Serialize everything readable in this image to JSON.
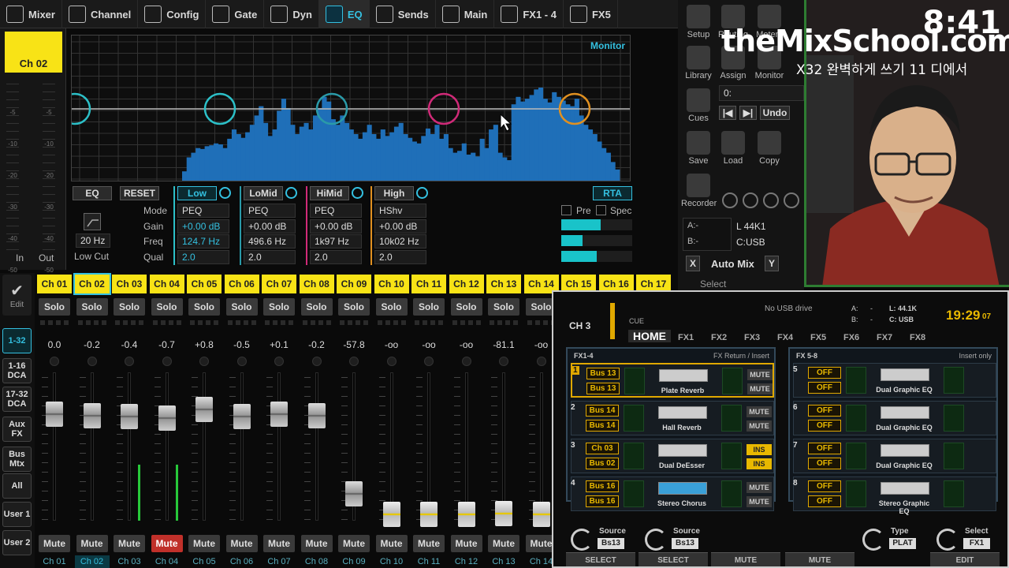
{
  "tabs": [
    {
      "label": "Mixer",
      "icon": "mixer-icon"
    },
    {
      "label": "Channel",
      "icon": "channel-icon"
    },
    {
      "label": "Config",
      "icon": "config-icon"
    },
    {
      "label": "Gate",
      "icon": "gate-icon"
    },
    {
      "label": "Dyn",
      "icon": "dynamics-icon"
    },
    {
      "label": "EQ",
      "icon": "eq-icon"
    },
    {
      "label": "Sends",
      "icon": "sends-icon"
    },
    {
      "label": "Main",
      "icon": "main-icon"
    },
    {
      "label": "FX1 - 4",
      "icon": "fx-icon"
    },
    {
      "label": "FX5",
      "icon": "fx5-icon"
    }
  ],
  "active_tab": "EQ",
  "channel_select": "Ch 02",
  "meter_scale": [
    "-5",
    "-10",
    "-20",
    "-30",
    "-40",
    "-50"
  ],
  "meter_in_label": "In",
  "meter_out_label": "Out",
  "eq": {
    "monitor_label": "Monitor",
    "eq_button": "EQ",
    "reset_button": "RESET",
    "lowcut_freq": "20 Hz",
    "lowcut_label": "Low Cut",
    "row_labels": [
      "Mode",
      "Gain",
      "Freq",
      "Qual"
    ],
    "bands": [
      {
        "name": "Low",
        "mode": "PEQ",
        "gain": "+0.00 dB",
        "freq": "124.7 Hz",
        "q": "2.0",
        "color": "#2cc0c8"
      },
      {
        "name": "LoMid",
        "mode": "PEQ",
        "gain": "+0.00 dB",
        "freq": "496.6 Hz",
        "q": "2.0",
        "color": "#2a9aa8"
      },
      {
        "name": "HiMid",
        "mode": "PEQ",
        "gain": "+0.00 dB",
        "freq": "1k97 Hz",
        "q": "2.0",
        "color": "#d02a78"
      },
      {
        "name": "High",
        "mode": "HShv",
        "gain": "+0.00 dB",
        "freq": "10k02 Hz",
        "q": "2.0",
        "color": "#e09020"
      }
    ],
    "rta_button": "RTA",
    "pre_label": "Pre",
    "spec_label": "Spec",
    "rta_levels": [
      0.55,
      0.3,
      0.5
    ]
  },
  "right_panel": {
    "items": [
      {
        "label": "Setup",
        "icon": "gear-icon"
      },
      {
        "label": "Routing",
        "icon": "routing-icon"
      },
      {
        "label": "Meters",
        "icon": "meters-icon"
      },
      {
        "label": "Library",
        "icon": "library-icon"
      },
      {
        "label": "Assign",
        "icon": "assign-icon"
      },
      {
        "label": "Monitor",
        "icon": "monitor-icon"
      },
      {
        "label": "Cues",
        "icon": "cues-icon"
      },
      {
        "label": "Save",
        "icon": "save-icon"
      },
      {
        "label": "Load",
        "icon": "load-icon"
      },
      {
        "label": "Copy",
        "icon": "copy-icon"
      },
      {
        "label": "Recorder",
        "icon": "recorder-icon"
      }
    ],
    "cue_value": "0:",
    "undo_label": "Undo",
    "a_label": "A:-",
    "b_label": "B:-",
    "l_rate": "L  44K1",
    "c_usb": "C:USB",
    "auto_mix": "Auto Mix",
    "x_btn": "X",
    "y_btn": "Y",
    "select_label": "Select"
  },
  "overlay": {
    "clock": "8:41",
    "brand": "theMixSchool.com",
    "subtitle": "X32 완벽하게 쓰기 11 디에서"
  },
  "left_nav": [
    "Edit",
    "1-32",
    "1-16 DCA",
    "17-32 DCA",
    "Aux FX",
    "Bus Mtx",
    "All",
    "User 1",
    "User 2"
  ],
  "strips": [
    {
      "name": "Ch 01",
      "val": "0.0",
      "fader": 0.72,
      "meter": 0,
      "mute": false
    },
    {
      "name": "Ch 02",
      "val": "-0.2",
      "fader": 0.71,
      "meter": 0,
      "mute": false,
      "selected": true
    },
    {
      "name": "Ch 03",
      "val": "-0.4",
      "fader": 0.7,
      "meter": 0.38,
      "mute": false
    },
    {
      "name": "Ch 04",
      "val": "-0.7",
      "fader": 0.69,
      "meter": 0.38,
      "mute": true
    },
    {
      "name": "Ch 05",
      "val": "+0.8",
      "fader": 0.75,
      "meter": 0,
      "mute": false
    },
    {
      "name": "Ch 06",
      "val": "-0.5",
      "fader": 0.7,
      "meter": 0,
      "mute": false
    },
    {
      "name": "Ch 07",
      "val": "+0.1",
      "fader": 0.72,
      "meter": 0,
      "mute": false
    },
    {
      "name": "Ch 08",
      "val": "-0.2",
      "fader": 0.71,
      "meter": 0,
      "mute": false
    },
    {
      "name": "Ch 09",
      "val": "-57.8",
      "fader": 0.18,
      "meter": 0,
      "mute": false
    },
    {
      "name": "Ch 10",
      "val": "-oo",
      "fader": 0.04,
      "meter": 0,
      "mute": false
    },
    {
      "name": "Ch 11",
      "val": "-oo",
      "fader": 0.04,
      "meter": 0,
      "mute": false
    },
    {
      "name": "Ch 12",
      "val": "-oo",
      "fader": 0.04,
      "meter": 0,
      "mute": false
    },
    {
      "name": "Ch 13",
      "val": "-81.1",
      "fader": 0.05,
      "meter": 0,
      "mute": false
    },
    {
      "name": "Ch 14",
      "val": "-oo",
      "fader": 0.04,
      "meter": 0,
      "mute": false
    },
    {
      "name": "Ch 15",
      "val": "",
      "fader": 0,
      "meter": 0,
      "mute": false
    },
    {
      "name": "Ch 16",
      "val": "",
      "fader": 0,
      "meter": 0,
      "mute": false
    },
    {
      "name": "Ch 17",
      "val": "",
      "fader": 0,
      "meter": 0,
      "mute": false
    }
  ],
  "solo_label": "Solo",
  "mute_label": "Mute",
  "x32": {
    "channel": "CH 3",
    "cue": "CUE",
    "usb": "No USB drive",
    "a": "A:",
    "b": "B:",
    "a_val": "-",
    "b_val": "-",
    "l_val": "L: 44.1K",
    "c_val": "C: USB",
    "time": "19:29",
    "time_sec": "07",
    "tabs": [
      "HOME",
      "FX1",
      "FX2",
      "FX3",
      "FX4",
      "FX5",
      "FX6",
      "FX7",
      "FX8"
    ],
    "left_title": "FX1-4",
    "left_sub": "FX Return / Insert",
    "right_title": "FX 5-8",
    "right_sub": "Insert only",
    "left_rows": [
      {
        "num": "1",
        "src": [
          "Bus 13",
          "Bus 13"
        ],
        "fx": "Plate Reverb",
        "btn": [
          "MUTE",
          "MUTE"
        ],
        "ins": false,
        "sel": true
      },
      {
        "num": "2",
        "src": [
          "Bus 14",
          "Bus 14"
        ],
        "fx": "Hall Reverb",
        "btn": [
          "MUTE",
          "MUTE"
        ],
        "ins": false
      },
      {
        "num": "3",
        "src": [
          "Ch 03",
          "Bus 02"
        ],
        "fx": "Dual DeEsser",
        "btn": [
          "INS",
          "INS"
        ],
        "ins": true
      },
      {
        "num": "4",
        "src": [
          "Bus 16",
          "Bus 16"
        ],
        "fx": "Stereo Chorus",
        "btn": [
          "MUTE",
          "MUTE"
        ],
        "ins": false
      }
    ],
    "right_rows": [
      {
        "num": "5",
        "src": [
          "OFF",
          "OFF"
        ],
        "fx": "Dual Graphic EQ"
      },
      {
        "num": "6",
        "src": [
          "OFF",
          "OFF"
        ],
        "fx": "Dual Graphic EQ"
      },
      {
        "num": "7",
        "src": [
          "OFF",
          "OFF"
        ],
        "fx": "Dual Graphic EQ"
      },
      {
        "num": "8",
        "src": [
          "OFF",
          "OFF"
        ],
        "fx": "Stereo Graphic EQ"
      }
    ],
    "bottom": [
      {
        "title": "Source",
        "value": "Bs13"
      },
      {
        "title": "Source",
        "value": "Bs13"
      },
      {
        "title": "Type",
        "value": "PLAT"
      },
      {
        "title": "Select",
        "value": "FX1"
      }
    ],
    "bottom_buttons": [
      "SELECT",
      "SELECT",
      "MUTE",
      "MUTE",
      "EDIT"
    ]
  },
  "rta_bars": [
    0.1,
    0.25,
    0.3,
    0.35,
    0.34,
    0.37,
    0.38,
    0.4,
    0.39,
    0.35,
    0.45,
    0.55,
    0.5,
    0.46,
    0.52,
    0.6,
    0.7,
    0.8,
    0.62,
    0.48,
    0.55,
    0.75,
    0.88,
    0.78,
    0.6,
    0.5,
    0.58,
    0.62,
    0.55,
    0.7,
    0.78,
    0.9,
    0.85,
    0.66,
    0.6,
    0.7,
    0.62,
    0.55,
    0.5,
    0.45,
    0.52,
    0.6,
    0.5,
    0.45,
    0.55,
    0.48,
    0.52,
    0.58,
    0.62,
    0.5,
    0.46,
    0.42,
    0.4,
    0.48,
    0.56,
    0.5,
    0.6,
    0.45,
    0.5,
    0.35,
    0.3,
    0.32,
    0.4,
    0.28,
    0.3,
    0.26,
    0.45,
    0.35,
    0.55,
    0.6,
    0.3,
    0.25,
    0.22,
    0.82,
    0.9,
    0.85,
    0.88,
    0.92,
    0.98,
    1.0,
    0.88,
    0.84,
    0.95,
    0.9,
    0.86,
    0.82,
    0.8,
    0.88,
    0.7,
    0.6,
    0.55,
    0.5,
    0.42,
    0.35,
    0.3,
    0.2,
    0.12
  ]
}
